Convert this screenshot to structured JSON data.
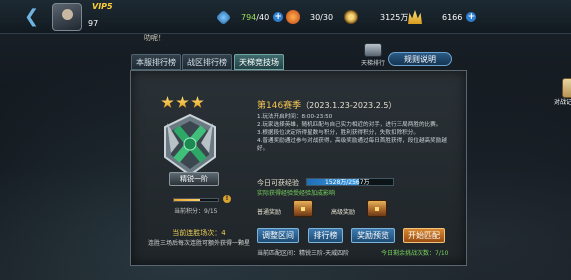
{
  "header": {
    "vip": "VIP5",
    "level": "97",
    "resources": {
      "energy_current": "794",
      "energy_max": "/40",
      "stamina": "30/30",
      "coins": "3125万",
      "gold": "6166"
    },
    "chat_text": "叻呢！"
  },
  "tabs": [
    {
      "label": "本服排行榜"
    },
    {
      "label": "战区排行榜"
    },
    {
      "label": "天梯竞技场"
    }
  ],
  "toolbar": {
    "rank_icon_label": "天梯排行",
    "rules_label": "规则说明"
  },
  "rank": {
    "stars": 3,
    "name": "精锐一阶",
    "score_text": "当前积分：9/15",
    "score_fraction": 0.6,
    "streak": "当前连胜场次：4",
    "streak_desc": "连胜三场后每次连胜可额外获得一颗星"
  },
  "season": {
    "title": "第146赛季",
    "range": "（2023.1.23-2023.2.5）",
    "history_label": "对战记录",
    "rules": [
      "1.玩法开启时间：8:00-23:50",
      "2.玩家选择英雄，随机匹配与自己实力相近的对手，进行三局两胜的比赛。",
      "3.根据段位决定所得星数与积分，胜利获得积分，失败扣除积分。",
      "4.普通奖励通过参与对战获得，高级奖励通过每日首胜获得，段位越高奖励越好。"
    ]
  },
  "exp": {
    "label": "今日可获经验",
    "value": "1528万/2567万",
    "fraction": 0.6,
    "note": "实际获得经验受经验加成影响"
  },
  "rewards": {
    "normal_label": "普通奖励",
    "advanced_label": "高级奖励"
  },
  "actions": {
    "adjust": "调整区间",
    "ranking": "排行榜",
    "preview": "奖励预览",
    "match": "开始匹配"
  },
  "footer": {
    "current_range": "当前匹配区间：精锐三阶-天威四阶",
    "remaining": "今日剩余挑战次数：7/10"
  },
  "colors": {
    "accent_gold": "#f0c252",
    "accent_green": "#7bd35f",
    "button_blue": "#3d7ab0",
    "button_orange": "#d8882f"
  }
}
